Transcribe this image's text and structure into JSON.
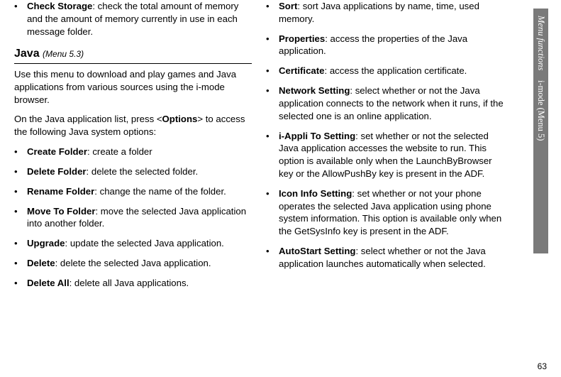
{
  "sidebar": {
    "chapter": "Menu functions",
    "section": "i-mode (Menu 5)"
  },
  "pageNumber": "63",
  "left": {
    "topItem": {
      "label": "Check Storage",
      "desc": ": check the total amount of memory and the amount of memory currently in use in each message folder."
    },
    "heading": "Java",
    "menuHint": "(Menu 5.3)",
    "para1": "Use this menu to download and play games and Java applications from various sources using the i-mode browser.",
    "para2_a": "On the Java application list, press <",
    "para2_b": "Options",
    "para2_c": "> to access the following Java system options:",
    "items": [
      {
        "label": "Create Folder",
        "desc": ": create a folder"
      },
      {
        "label": "Delete Folder",
        "desc": ": delete the selected folder."
      },
      {
        "label": "Rename Folder",
        "desc": ": change the name of the folder."
      },
      {
        "label": "Move To Folder",
        "desc": ": move the selected Java application into another folder."
      },
      {
        "label": "Upgrade",
        "desc": ": update the selected Java application."
      },
      {
        "label": "Delete",
        "desc": ": delete the selected Java application."
      },
      {
        "label": "Delete All",
        "desc": ": delete all Java applications."
      }
    ]
  },
  "right": {
    "items": [
      {
        "label": "Sort",
        "desc": ": sort Java applications by name, time, used memory."
      },
      {
        "label": "Properties",
        "desc": ": access the properties of the Java application."
      },
      {
        "label": "Certificate",
        "desc": ": access the application certificate."
      },
      {
        "label": "Network Setting",
        "desc": ": select whether or not the Java application connects to the network when it runs, if the selected one is an online application."
      },
      {
        "label": "i-Appli To Setting",
        "desc": ": set whether or not the selected Java application accesses the website to run. This option is available only when the LaunchByBrowser key or the AllowPushBy key is present in the ADF."
      },
      {
        "label": "Icon Info Setting",
        "desc": ": set whether or not your phone operates the selected Java application using phone system information. This option is available only when the GetSysInfo key is present in the ADF."
      },
      {
        "label": "AutoStart Setting",
        "desc": ": select whether or not the Java application launches automatically when selected."
      }
    ]
  }
}
